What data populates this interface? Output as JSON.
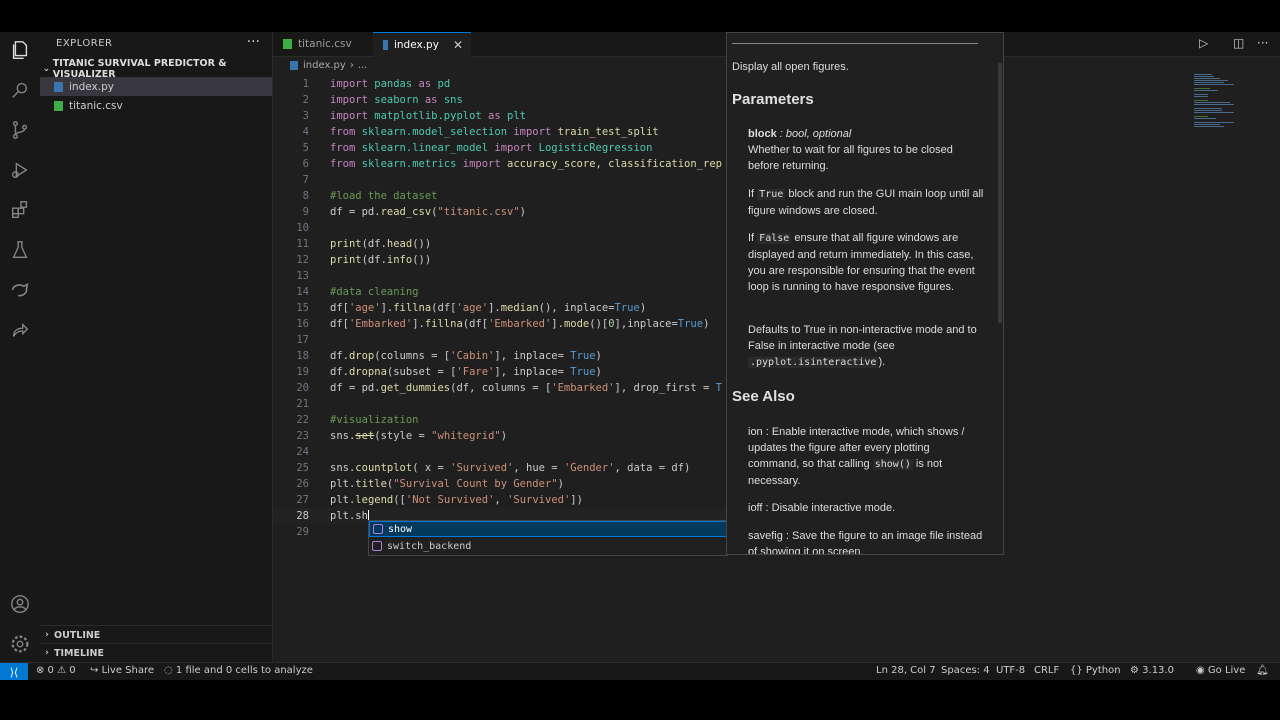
{
  "sidebar": {
    "header": "EXPLORER",
    "more": "···",
    "project": "TITANIC SURVIVAL PREDICTOR & VISUALIZER",
    "files": [
      {
        "name": "index.py",
        "selected": true
      },
      {
        "name": "titanic.csv",
        "selected": false
      }
    ],
    "outline": "OUTLINE",
    "timeline": "TIMELINE"
  },
  "tabs": [
    {
      "label": "titanic.csv",
      "active": false
    },
    {
      "label": "index.py",
      "active": true,
      "close": "✕"
    }
  ],
  "breadcrumb": {
    "file": "index.py",
    "sep": "›",
    "rest": "..."
  },
  "editor": {
    "lines": [
      {
        "n": "1"
      },
      {
        "n": "2"
      },
      {
        "n": "3"
      },
      {
        "n": "4"
      },
      {
        "n": "5"
      },
      {
        "n": "6"
      },
      {
        "n": "7"
      },
      {
        "n": "8"
      },
      {
        "n": "9"
      },
      {
        "n": "10"
      },
      {
        "n": "11"
      },
      {
        "n": "12"
      },
      {
        "n": "13"
      },
      {
        "n": "14"
      },
      {
        "n": "15"
      },
      {
        "n": "16"
      },
      {
        "n": "17"
      },
      {
        "n": "18"
      },
      {
        "n": "19"
      },
      {
        "n": "20"
      },
      {
        "n": "21"
      },
      {
        "n": "22"
      },
      {
        "n": "23"
      },
      {
        "n": "24"
      },
      {
        "n": "25"
      },
      {
        "n": "26"
      },
      {
        "n": "27"
      },
      {
        "n": "28"
      },
      {
        "n": "29"
      }
    ],
    "code": {
      "l1": [
        "import",
        " pandas ",
        "as",
        " pd"
      ],
      "l2": [
        "import",
        " seaborn ",
        "as",
        " sns"
      ],
      "l3": [
        "import",
        " matplotlib.pyplot ",
        "as",
        " plt"
      ],
      "l4": [
        "from",
        " sklearn.model_selection ",
        "import",
        " train_test_split"
      ],
      "l5": [
        "from",
        " sklearn.linear_model ",
        "import",
        " LogisticRegression"
      ],
      "l6": [
        "from",
        " sklearn.metrics ",
        "import",
        " accuracy_score, classification_rep"
      ],
      "l8": "#load the dataset",
      "l9": [
        "df = pd.",
        "read_csv",
        "(",
        "\"titanic.csv\"",
        ")"
      ],
      "l11": [
        "print",
        "(df.",
        "head",
        "())"
      ],
      "l12": [
        "print",
        "(df.",
        "info",
        "())"
      ],
      "l14": "#data cleaning",
      "l15": [
        "df[",
        "'age'",
        "].",
        "fillna",
        "(df[",
        "'age'",
        "].",
        "median",
        "(), inplace=",
        "True",
        ")"
      ],
      "l16": [
        "df[",
        "'Embarked'",
        "].",
        "fillna",
        "(df[",
        "'Embarked'",
        "].",
        "mode",
        "()[",
        "0",
        "],inplace=",
        "True",
        ")"
      ],
      "l18": [
        "df.",
        "drop",
        "(columns = [",
        "'Cabin'",
        "], inplace= ",
        "True",
        ")"
      ],
      "l19": [
        "df.",
        "dropna",
        "(subset = [",
        "'Fare'",
        "], inplace= ",
        "True",
        ")"
      ],
      "l20": [
        "df = pd.",
        "get_dummies",
        "(df, columns = [",
        "'Embarked'",
        "], drop_first = ",
        "T"
      ],
      "l22": "#visualization",
      "l23": [
        "sns.",
        "set",
        "(style = ",
        "\"whitegrid\"",
        ")"
      ],
      "l25": [
        "sns.",
        "countplot",
        "( x = ",
        "'Survived'",
        ", hue = ",
        "'Gender'",
        ", data = df)"
      ],
      "l26": [
        "plt.",
        "title",
        "(",
        "\"Survival Count by Gender\"",
        ")"
      ],
      "l27": [
        "plt.",
        "legend",
        "([",
        "'Not Survived'",
        ", ",
        "'Survived'",
        "])"
      ],
      "l28": "plt.sh"
    }
  },
  "suggest": {
    "items": [
      "show",
      "switch_backend"
    ]
  },
  "hover": {
    "desc": "Display all open figures.",
    "params_title": "Parameters",
    "block_name": "block",
    "block_type": " : bool, optional",
    "block_desc": "Whether to wait for all figures to be closed before returning.",
    "if_true_pre": "If ",
    "if_true_code": "True",
    "if_true_post": " block and run the GUI main loop until all figure windows are closed.",
    "if_false_pre": "If ",
    "if_false_code": "False",
    "if_false_post": " ensure that all figure windows are displayed and return immediately. In this case, you are responsible for ensuring that the event loop is running to have responsive figures.",
    "defaults": "Defaults to True in non-interactive mode and to False in interactive mode (see",
    "defaults_code": ".pyplot.isinteractive",
    "defaults_end": ").",
    "see_also": "See Also",
    "ion": "ion : Enable interactive mode, which shows / updates the figure after every plotting command, so that calling ",
    "ion_code": "show()",
    "ion_end": " is not necessary.",
    "ioff": "ioff : Disable interactive mode.",
    "savefig": "savefig : Save the figure to an image file instead of showing it on screen."
  },
  "status": {
    "problems": "⊗ 0 ⚠ 0",
    "liveshare": "Live Share",
    "analyze": "1 file and 0 cells to analyze",
    "position": "Ln 28, Col 7",
    "spaces": "Spaces: 4",
    "encoding": "UTF-8",
    "eol": "CRLF",
    "language": "Python",
    "version": "3.13.0",
    "golive": "Go Live"
  },
  "colors": {
    "accent": "#0078d4",
    "keyword": "#c586c0",
    "string": "#ce9178",
    "comment": "#6a9955",
    "function": "#dcdcaa"
  }
}
